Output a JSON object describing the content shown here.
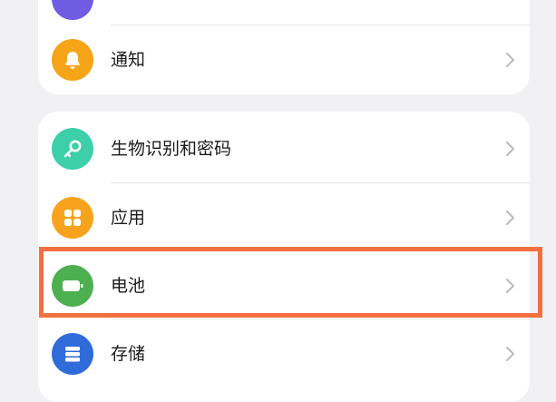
{
  "settings": {
    "items": [
      {
        "label": "",
        "icon": "partially-visible-icon",
        "color": "#6f5ce2"
      },
      {
        "label": "通知",
        "icon": "bell-icon",
        "color": "#f6a418"
      },
      {
        "label": "生物识别和密码",
        "icon": "key-icon",
        "color": "#3ccfa8"
      },
      {
        "label": "应用",
        "icon": "grid-icon",
        "color": "#f8a31e"
      },
      {
        "label": "电池",
        "icon": "battery-icon",
        "color": "#4caf50"
      },
      {
        "label": "存储",
        "icon": "storage-icon",
        "color": "#2f6bd9"
      }
    ]
  },
  "highlight": {
    "color": "#f26f3f",
    "target": "电池"
  }
}
